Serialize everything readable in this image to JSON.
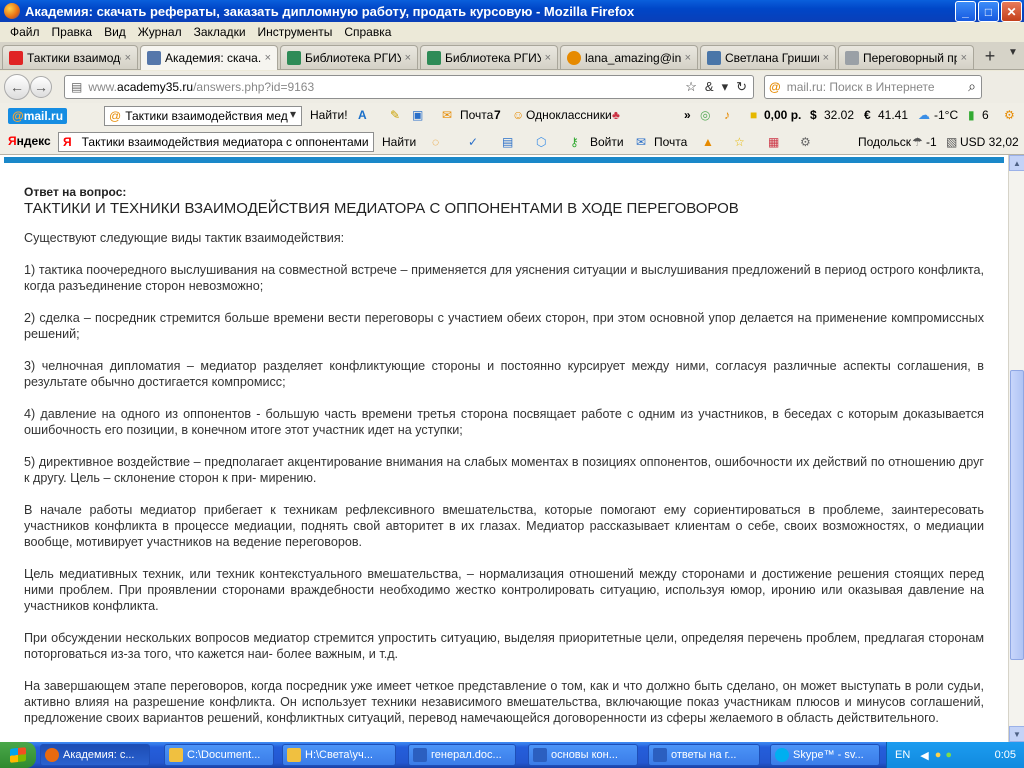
{
  "window": {
    "title": "Академия: скачать рефераты, заказать дипломную работу, продать курсовую - Mozilla Firefox",
    "minimize": "_",
    "maximize": "□",
    "close": "✕"
  },
  "menu": [
    "Файл",
    "Правка",
    "Вид",
    "Журнал",
    "Закладки",
    "Инструменты",
    "Справка"
  ],
  "tabs": [
    {
      "label": "Тактики взаимодей...",
      "icon_color": "#e02424"
    },
    {
      "label": "Академия: скача...",
      "icon_color": "#5577aa",
      "active": true
    },
    {
      "label": "Библиотека РГИУ ::...",
      "icon_color": "#2e8b57"
    },
    {
      "label": "Библиотека РГИУ ::...",
      "icon_color": "#2e8b57"
    },
    {
      "label": "lana_amazing@inbox...",
      "icon_color": "#e68a00"
    },
    {
      "label": "Светлана Гришина",
      "icon_color": "#4a76a8"
    },
    {
      "label": "Переговорный проц...",
      "icon_color": "#9aa0a6"
    }
  ],
  "tab_close": "×",
  "newtab": "+",
  "navbar": {
    "url_host": "www.",
    "url_domain": "academy35.ru",
    "url_path": "/answers.php?id=9163",
    "search_engine": "@",
    "search_placeholder": "mail.ru: Поиск в Интернете"
  },
  "mailbar": {
    "logo_at": "@",
    "logo_text": "mail.ru",
    "search_value": "Тактики взаимодействия мед",
    "find_label": "Найти!",
    "mail_label": "Почта",
    "mail_count": "7",
    "odnoklassniki_label": "Одноклассники",
    "more": "»",
    "money": "0,00 р.",
    "usd": "32.02",
    "eur": "41.41",
    "weather": "-1°C",
    "traffic": "6"
  },
  "yabar": {
    "logo": "Яндекс",
    "search_value": "Тактики взаимодействия медиатора с оппонентами",
    "find_label": "Найти",
    "login_label": "Войти",
    "mail_label": "Почта",
    "city": "Подольск",
    "city_val": "-1",
    "usd": "USD 32,02"
  },
  "article": {
    "label": "Ответ на вопрос:",
    "title": "ТАКТИКИ И ТЕХНИКИ ВЗАИМОДЕЙСТВИЯ МЕДИАТОРА С ОППОНЕНТАМИ В ХОДЕ ПЕРЕГОВОРОВ",
    "paragraphs": [
      "Существуют следующие виды тактик взаимодействия:",
      "1) тактика поочередного выслушивания на совместной встрече – применяется для уяснения ситуации и выслушивания предложений в период острого конфликта, когда разъединение сторон невозможно;",
      "2) сделка – посредник стремится больше времени вести переговоры с участием обеих сторон, при этом основной упор делается на применение компромиссных решений;",
      "3) челночная дипломатия – медиатор разделяет конфликтующие стороны и постоянно курсирует между ними, согласуя различные аспекты соглашения, в результате обычно достигается компромисс;",
      "4) давление на одного из оппонентов - большую часть времени третья сторона посвящает работе с одним из участников, в беседах с которым доказывается ошибочность его позиции, в конечном итоге этот участник идет на уступки;",
      "5) директивное воздействие – предполагает акцентирование внимания на слабых моментах в позициях оппонентов, ошибочности их действий по отношению друг к другу. Цель – склонение сторон к при- мирению.",
      "В начале работы медиатор прибегает к техникам рефлексивного вмешательства, которые помогают ему сориентироваться в проблеме, заинтересовать участников конфликта в процессе медиации, поднять свой авторитет в их глазах. Медиатор рассказывает клиентам о себе, своих возможностях, о медиации вообще, мотивирует участников на ведение переговоров.",
      "Цель медиативных техник, или техник контекстуального вмешательства, – нормализация отношений между сторонами и достижение решения стоящих перед ними проблем. При проявлении сторонами враждебности необходимо жестко контролировать ситуацию, используя юмор, иронию или оказывая давление на участников конфликта.",
      "При обсуждении нескольких вопросов медиатор стремится упростить ситуацию, выделяя приоритетные цели, определяя перечень проблем, предлагая сторонам поторговаться из-за того, что кажется наи- более важным, и т.д.",
      "На завершающем этапе переговоров, когда посредник уже имеет четкое представление о том, как и что должно быть сделано, он может выступать в роли судьи, активно влияя на разрешение конфликта. Он использует техники независимого вмешательства, включающие показ участникам плюсов и минусов соглашений, предложение своих вариантов решений, конфликтных ситуаций, перевод намечающейся договоренности из сферы желаемого в область действительного."
    ]
  },
  "taskbar": {
    "items": [
      {
        "label": "Академия: с...",
        "icon_color": "#e86a10",
        "active": true
      },
      {
        "label": "C:\\Document...",
        "icon_color": "#f0c040"
      },
      {
        "label": "H:\\Света\\уч...",
        "icon_color": "#f0c040"
      },
      {
        "label": "генерал.doc...",
        "icon_color": "#2b5fc0"
      },
      {
        "label": "основы кон...",
        "icon_color": "#2b5fc0"
      },
      {
        "label": "ответы на г...",
        "icon_color": "#2b5fc0"
      },
      {
        "label": "Skype™ - sv...",
        "icon_color": "#00aff0"
      }
    ],
    "lang": "EN",
    "clock": "0:05"
  }
}
